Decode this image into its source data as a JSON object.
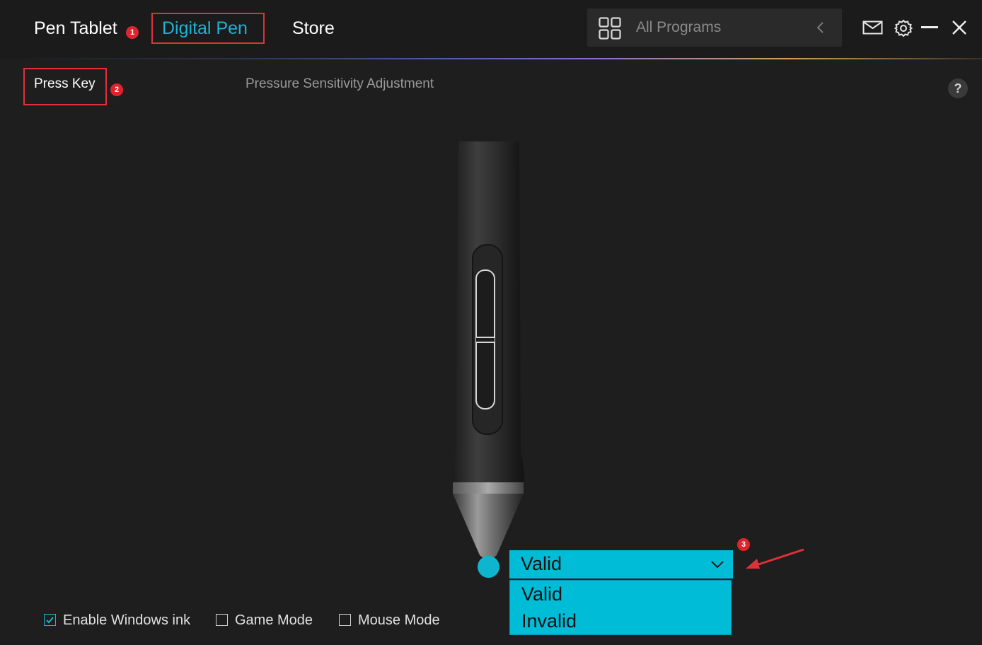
{
  "header": {
    "tabs": [
      {
        "label": "Pen Tablet",
        "active": false
      },
      {
        "label": "Digital Pen",
        "active": true
      },
      {
        "label": "Store",
        "active": false
      }
    ],
    "programs_label": "All Programs",
    "icons": [
      "grid-icon",
      "chevron-left-icon",
      "mail-icon",
      "gear-icon",
      "minimize-icon",
      "close-icon"
    ]
  },
  "annotations": {
    "badge1": "1",
    "badge2": "2",
    "badge3": "3"
  },
  "subtabs": [
    {
      "label": "Press Key",
      "active": true
    },
    {
      "label": "Pressure Sensitivity Adjustment",
      "active": false
    }
  ],
  "help_label": "?",
  "tip_setting": {
    "selected": "Valid",
    "options": [
      "Valid",
      "Invalid"
    ]
  },
  "options": [
    {
      "label": "Enable Windows ink",
      "checked": true
    },
    {
      "label": "Game Mode",
      "checked": false
    },
    {
      "label": "Mouse Mode",
      "checked": false
    }
  ],
  "colors": {
    "accent": "#00bcd6",
    "tab_active": "#1cb3d4",
    "annotation": "#e0303a",
    "background": "#1e1e1e"
  }
}
